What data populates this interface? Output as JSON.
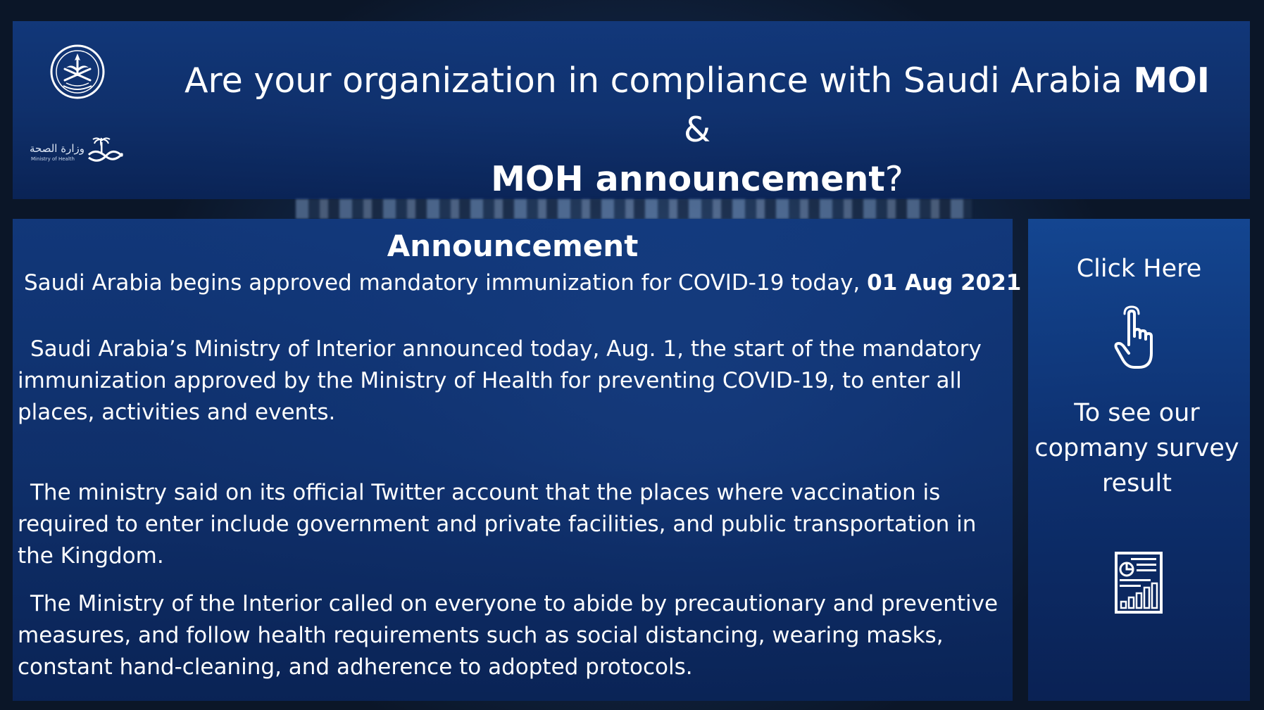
{
  "header": {
    "title_pre": "Are your organization in compliance with Saudi Arabia ",
    "title_moi": "MOI",
    "title_amp": " & ",
    "title_moh": "MOH announcement",
    "title_q": "?",
    "moh_logo_ar": "وزارة الصحة",
    "moh_logo_en": "Ministry of Health",
    "emblem_icon": "saudi-emblem-icon"
  },
  "announcement": {
    "heading": "Announcement",
    "subtitle_text": "Saudi Arabia begins approved mandatory immunization for COVID-19 today, ",
    "subtitle_date": "01 Aug 2021",
    "paragraphs": [
      "Saudi Arabia’s Ministry of Interior announced today, Aug. 1, the start of the mandatory immunization approved by the Ministry of Health for preventing COVID-19, to enter all places, activities and events.",
      "The ministry said on its official Twitter account that the places where vaccination is required to enter include government and private facilities, and public transportation in the Kingdom.",
      "The Ministry of the Interior called on everyone to abide by precautionary and preventive measures, and follow health requirements such as social distancing, wearing masks, constant hand-cleaning, and adherence to adopted protocols."
    ]
  },
  "sidebar": {
    "click_label": "Click Here",
    "hand_icon": "pointer-hand-icon",
    "description": "To see our copmany survey result",
    "report_icon": "report-chart-icon"
  },
  "colors": {
    "panel_blue": "#123a80",
    "background": "#151a22",
    "text": "#ffffff"
  }
}
